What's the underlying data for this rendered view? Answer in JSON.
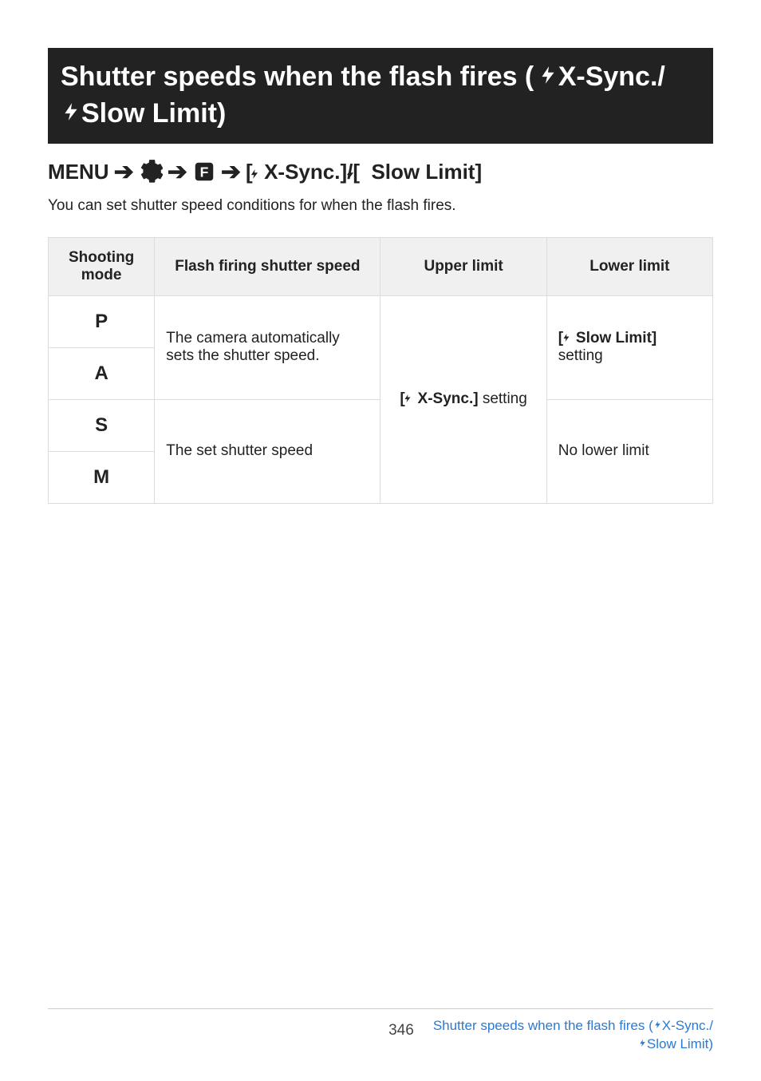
{
  "title": {
    "part1": "Shutter speeds when the flash fires (",
    "xsync": "X-Sync./",
    "slow": "Slow Limit)"
  },
  "menu": {
    "label": "MENU",
    "setting": "[  X-Sync.]/[  Slow Limit]"
  },
  "description": "You can set shutter speed conditions for when the flash fires.",
  "table": {
    "headers": [
      "Shooting mode",
      "Flash firing shutter speed",
      "Upper limit",
      "Lower limit"
    ],
    "modes": [
      "P",
      "A",
      "S",
      "M"
    ],
    "flash_speed_pa": "The camera automatically sets the shutter speed.",
    "flash_speed_sm": "The set shutter speed",
    "upper_label_bold": "[   X-Sync.]",
    "upper_label_rest": " setting",
    "lower_pa_bold": "[   Slow Limit]",
    "lower_pa_rest": " setting",
    "lower_sm": "No lower limit"
  },
  "footer": {
    "page": "346",
    "link_part1": "Shutter speeds when the flash fires (",
    "link_xsync": "X-Sync./",
    "link_slow": "Slow Limit)"
  }
}
